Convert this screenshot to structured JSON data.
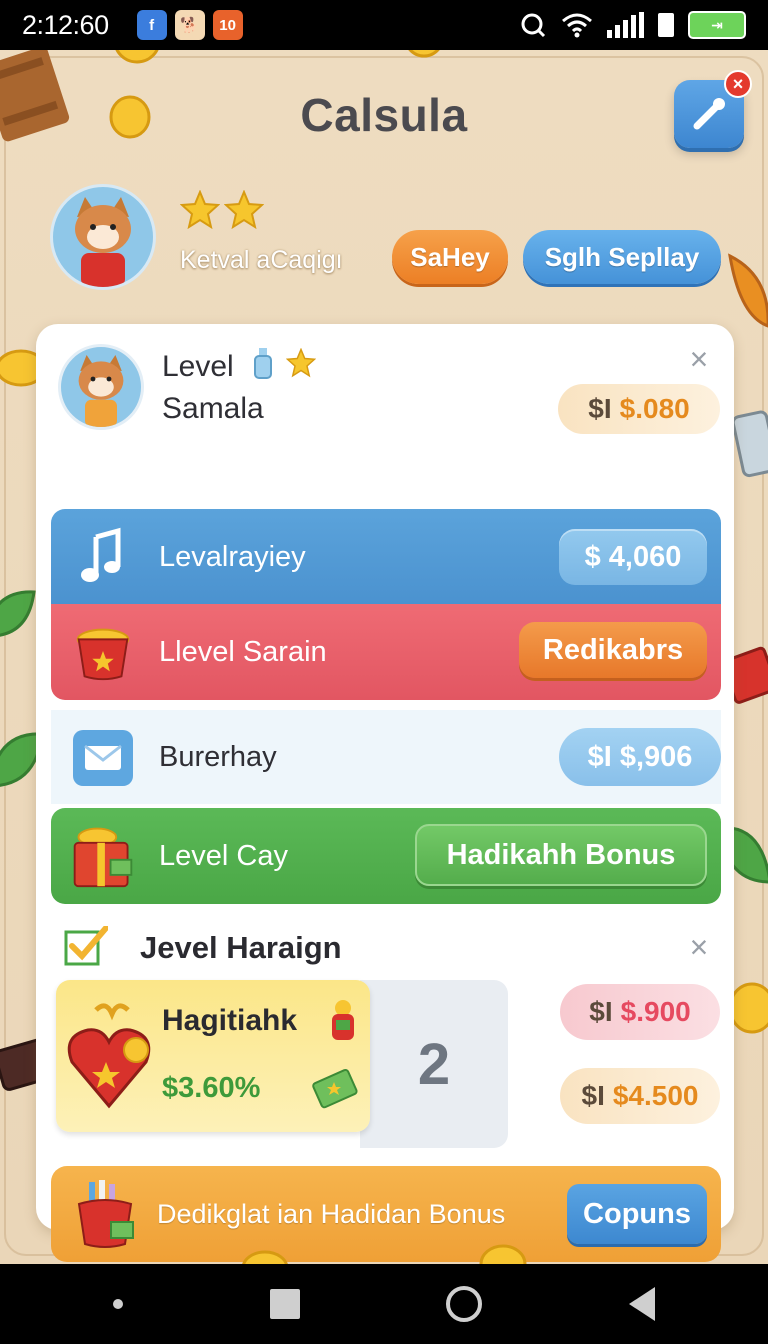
{
  "status_bar": {
    "time": "2:12:60",
    "notifications": [
      {
        "icon": "facebook-icon",
        "text": "f"
      },
      {
        "icon": "dog-app-icon",
        "text": "🐕"
      },
      {
        "icon": "ten-app-icon",
        "text": "10"
      }
    ],
    "battery_label": "⇥"
  },
  "header": {
    "title": "Calsula",
    "settings_badge": "×",
    "subtitle": "Ketval aCaqigı",
    "stars": 2,
    "button_left": "SaHey",
    "button_right": "Sglh Sepllay"
  },
  "card": {
    "level_title": "Level",
    "level_subtitle": "Samala",
    "level_price_prefix": "$I",
    "level_price": "$.080",
    "rows": [
      {
        "label": "Levalrayiey",
        "action": "$ 4,060"
      },
      {
        "label": "Llevel Sarain",
        "action": "Redikabrs"
      },
      {
        "label": "Burerhay",
        "action": "$I $,906"
      },
      {
        "label": "Level Cay",
        "action": "Hadikahh Bonus"
      }
    ],
    "section_title": "Jevel Haraign",
    "gift": {
      "title": "Hagitiahk",
      "percent": "$3.60%"
    },
    "count": "2",
    "price_pink_prefix": "$I",
    "price_pink": "$.900",
    "price_cream_prefix": "$I",
    "price_cream": "$4.500",
    "bonus_text": "Dedikglat ian Hadidan Bonus",
    "bonus_button": "Copuns"
  },
  "colors": {
    "accent_blue": "#4b92cf",
    "accent_red": "#e25662",
    "accent_green": "#4aa746",
    "accent_orange": "#efa036",
    "background": "#ead6b8"
  }
}
